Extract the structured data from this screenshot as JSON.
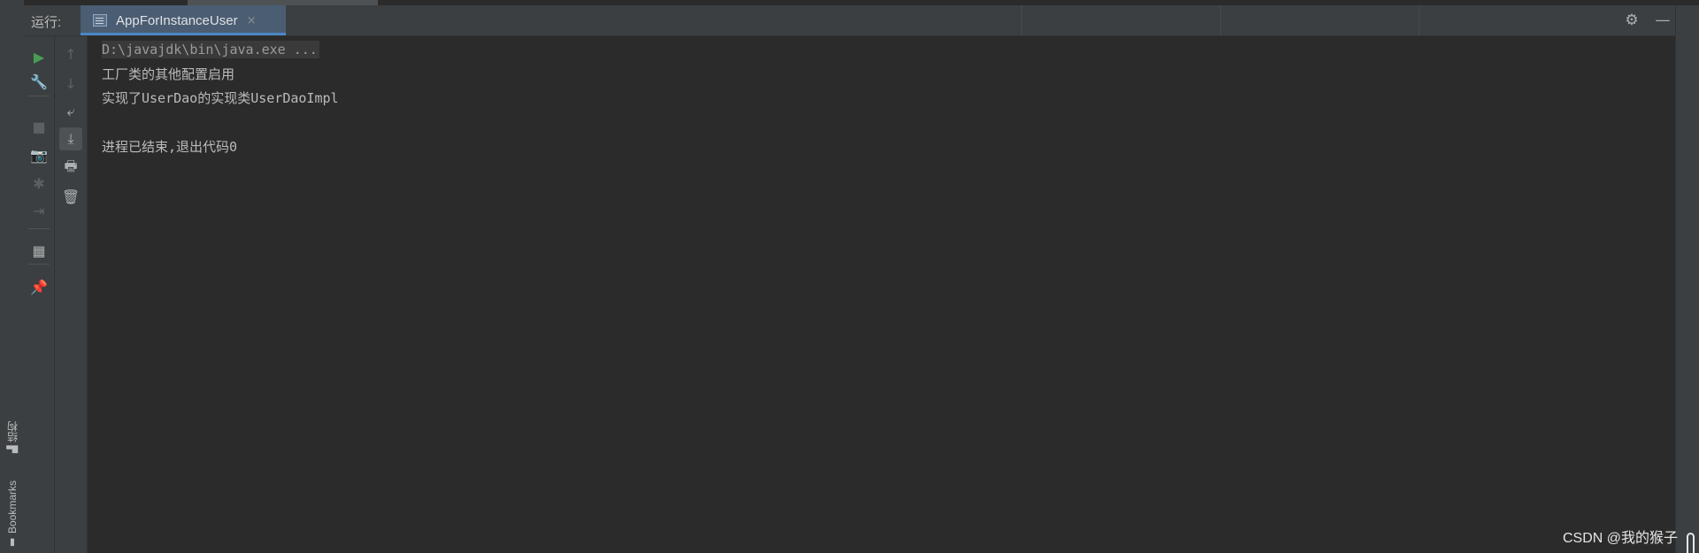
{
  "left_strip": {
    "tabs": [
      {
        "label": "结构",
        "icon": "structure-icon"
      },
      {
        "label": "Bookmarks",
        "icon": "bookmark-icon"
      }
    ]
  },
  "run_window": {
    "label": "运行:",
    "tab": {
      "title": "AppForInstanceUser",
      "close": "×",
      "icon": "console-icon"
    },
    "actions": {
      "settings": "⚙",
      "hide": "—"
    }
  },
  "toolbar_primary": [
    {
      "name": "rerun-icon",
      "glyph": "▶",
      "enabled": true,
      "color": "#499c54"
    },
    {
      "name": "edit-config-icon",
      "glyph": "🔧",
      "enabled": true
    },
    {
      "name": "stop-icon",
      "glyph": "■",
      "enabled": false
    },
    {
      "name": "dump-threads-icon",
      "glyph": "📷",
      "enabled": false
    },
    {
      "name": "debug-bug-icon",
      "glyph": "✱",
      "enabled": false
    },
    {
      "name": "exit-icon",
      "glyph": "⇥",
      "enabled": false
    },
    {
      "name": "layout-icon",
      "glyph": "▦",
      "enabled": true
    },
    {
      "name": "pin-icon",
      "glyph": "📌",
      "enabled": true
    }
  ],
  "toolbar_secondary": [
    {
      "name": "up-arrow-icon",
      "glyph": "↑",
      "enabled": false
    },
    {
      "name": "down-arrow-icon",
      "glyph": "↓",
      "enabled": false
    },
    {
      "name": "soft-wrap-icon",
      "glyph": "⤶",
      "enabled": true
    },
    {
      "name": "scroll-to-end-icon",
      "glyph": "⤓",
      "enabled": true,
      "active": true
    },
    {
      "name": "print-icon",
      "glyph": "🖶",
      "enabled": true
    },
    {
      "name": "trash-icon",
      "glyph": "🗑",
      "enabled": true
    }
  ],
  "console": {
    "lines": [
      "D:\\javajdk\\bin\\java.exe ...",
      "工厂类的其他配置启用",
      "实现了UserDao的实现类UserDaoImpl",
      "",
      "进程已结束,退出代码0"
    ]
  },
  "watermark": "CSDN @我的猴子"
}
